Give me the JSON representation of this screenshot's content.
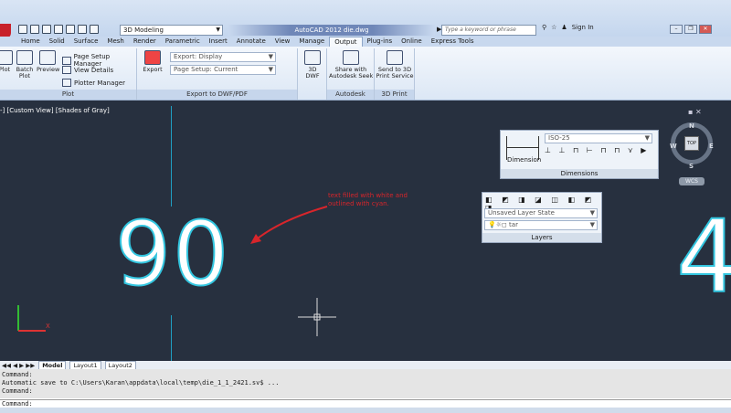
{
  "titlebar": {
    "workspace": "3D Modeling",
    "app_title": "AutoCAD 2012   die.dwg",
    "search_placeholder": "Type a keyword or phrase",
    "sign_in": "Sign In"
  },
  "tabs": [
    "Home",
    "Solid",
    "Surface",
    "Mesh",
    "Render",
    "Parametric",
    "Insert",
    "Annotate",
    "View",
    "Manage",
    "Output",
    "Plug-ins",
    "Online",
    "Express Tools"
  ],
  "ribbon": {
    "plot": {
      "title": "Plot",
      "plot": "Plot",
      "batch_plot": "Batch\nPlot",
      "preview": "Preview",
      "page_setup_manager": "Page Setup Manager",
      "view_details": "View Details",
      "plotter_manager": "Plotter Manager"
    },
    "export": {
      "title": "Export to DWF/PDF",
      "export": "Export",
      "export_display": "Export: Display",
      "page_setup": "Page Setup: Current"
    },
    "dwf": {
      "label": "3D DWF"
    },
    "seek": {
      "title": "Autodesk Seek",
      "label": "Share with\nAutodesk Seek"
    },
    "print3d": {
      "title": "3D Print",
      "label": "Send to 3D\nPrint Service"
    }
  },
  "viewport": {
    "label": "-] [Custom View] [Shades of Gray]",
    "big_text": "90",
    "right_text": "4",
    "annotation": "text filled with white and outlined with cyan."
  },
  "dimensions_panel": {
    "title": "Dimensions",
    "style": "ISO-25",
    "label": "Dimension"
  },
  "layers_panel": {
    "title": "Layers",
    "state": "Unsaved Layer State",
    "layer": "tar"
  },
  "compass": {
    "n": "N",
    "s": "S",
    "e": "E",
    "w": "W",
    "top": "TOP",
    "wcs": "WCS"
  },
  "layout_tabs": [
    "Model",
    "Layout1",
    "Layout2"
  ],
  "command": {
    "line1": "Command:",
    "line2": "Automatic save to C:\\Users\\Karan\\appdata\\local\\temp\\die_1_1_2421.sv$ ...",
    "line3": "Command:",
    "prompt": "Command:"
  }
}
